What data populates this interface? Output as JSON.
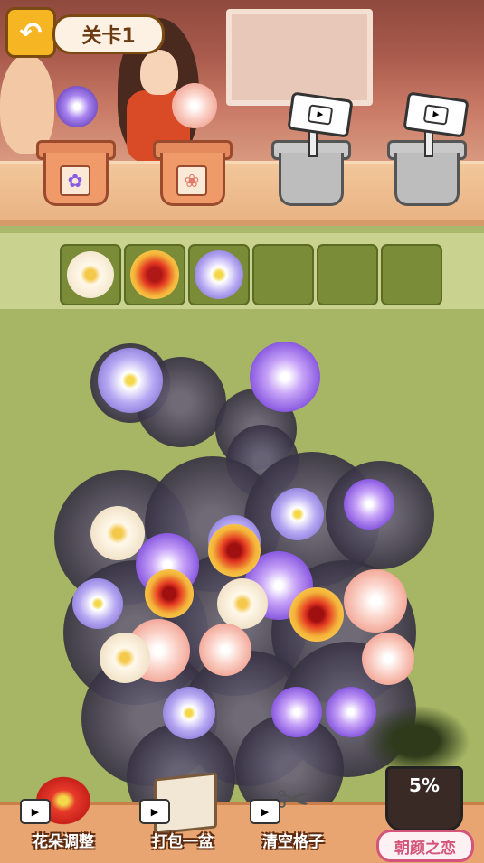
{
  "header": {
    "back_icon": "back-arrow-icon",
    "level_label": "关卡1"
  },
  "shelf": {
    "pots": [
      {
        "type": "clay",
        "flower": "purple-lily",
        "badge_icon": "purple-lily-icon"
      },
      {
        "type": "clay",
        "flower": "pink-blossom",
        "badge_icon": "pink-blossom-icon"
      },
      {
        "type": "steel",
        "locked": true,
        "sign_icon": "video-icon"
      },
      {
        "type": "steel",
        "locked": true,
        "sign_icon": "video-icon"
      }
    ]
  },
  "slots": {
    "items": [
      {
        "flower": "white-blossom",
        "color": "#fdf6e6"
      },
      {
        "flower": "red-daisy",
        "color": "#e04a2a"
      },
      {
        "flower": "violet-pansy",
        "color": "#b6a8f2"
      },
      {
        "flower": null
      },
      {
        "flower": null
      },
      {
        "flower": null
      }
    ]
  },
  "toolbar": {
    "items": [
      {
        "label": "花朵调整",
        "icon": "flower-adjust-icon"
      },
      {
        "label": "打包一盆",
        "icon": "box-icon"
      },
      {
        "label": "清空格子",
        "icon": "scissors-icon"
      }
    ],
    "progress_text": "5%",
    "name_button": "朝颜之恋"
  },
  "colors": {
    "accent": "#f6b623",
    "field": "#a6b664",
    "slot": "#7a8c38"
  }
}
